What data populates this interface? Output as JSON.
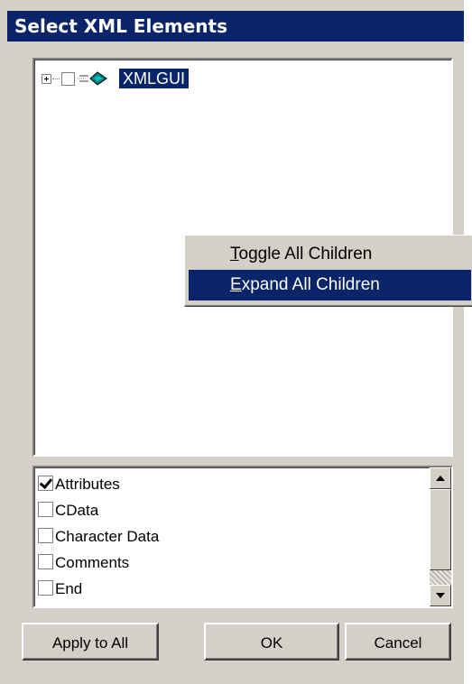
{
  "window": {
    "title": "Select XML Elements"
  },
  "tree": {
    "root": {
      "label": "XMLGUI",
      "checked": false,
      "selected": true,
      "icon": "xml-element-icon"
    }
  },
  "context_menu": {
    "items": [
      {
        "mnemonic": "T",
        "rest": "oggle All Children",
        "highlighted": false
      },
      {
        "mnemonic": "E",
        "rest": "xpand All Children",
        "highlighted": true
      }
    ]
  },
  "filter_list": {
    "items": [
      {
        "label": "Attributes",
        "checked": true
      },
      {
        "label": "CData",
        "checked": false
      },
      {
        "label": "Character Data",
        "checked": false
      },
      {
        "label": "Comments",
        "checked": false
      },
      {
        "label": "End",
        "checked": false
      }
    ]
  },
  "buttons": {
    "apply_to_all": "Apply to All",
    "ok": "OK",
    "cancel": "Cancel"
  },
  "colors": {
    "face": "#d4d0c8",
    "selection": "#0a246a",
    "title_bar": "#0a246a"
  }
}
